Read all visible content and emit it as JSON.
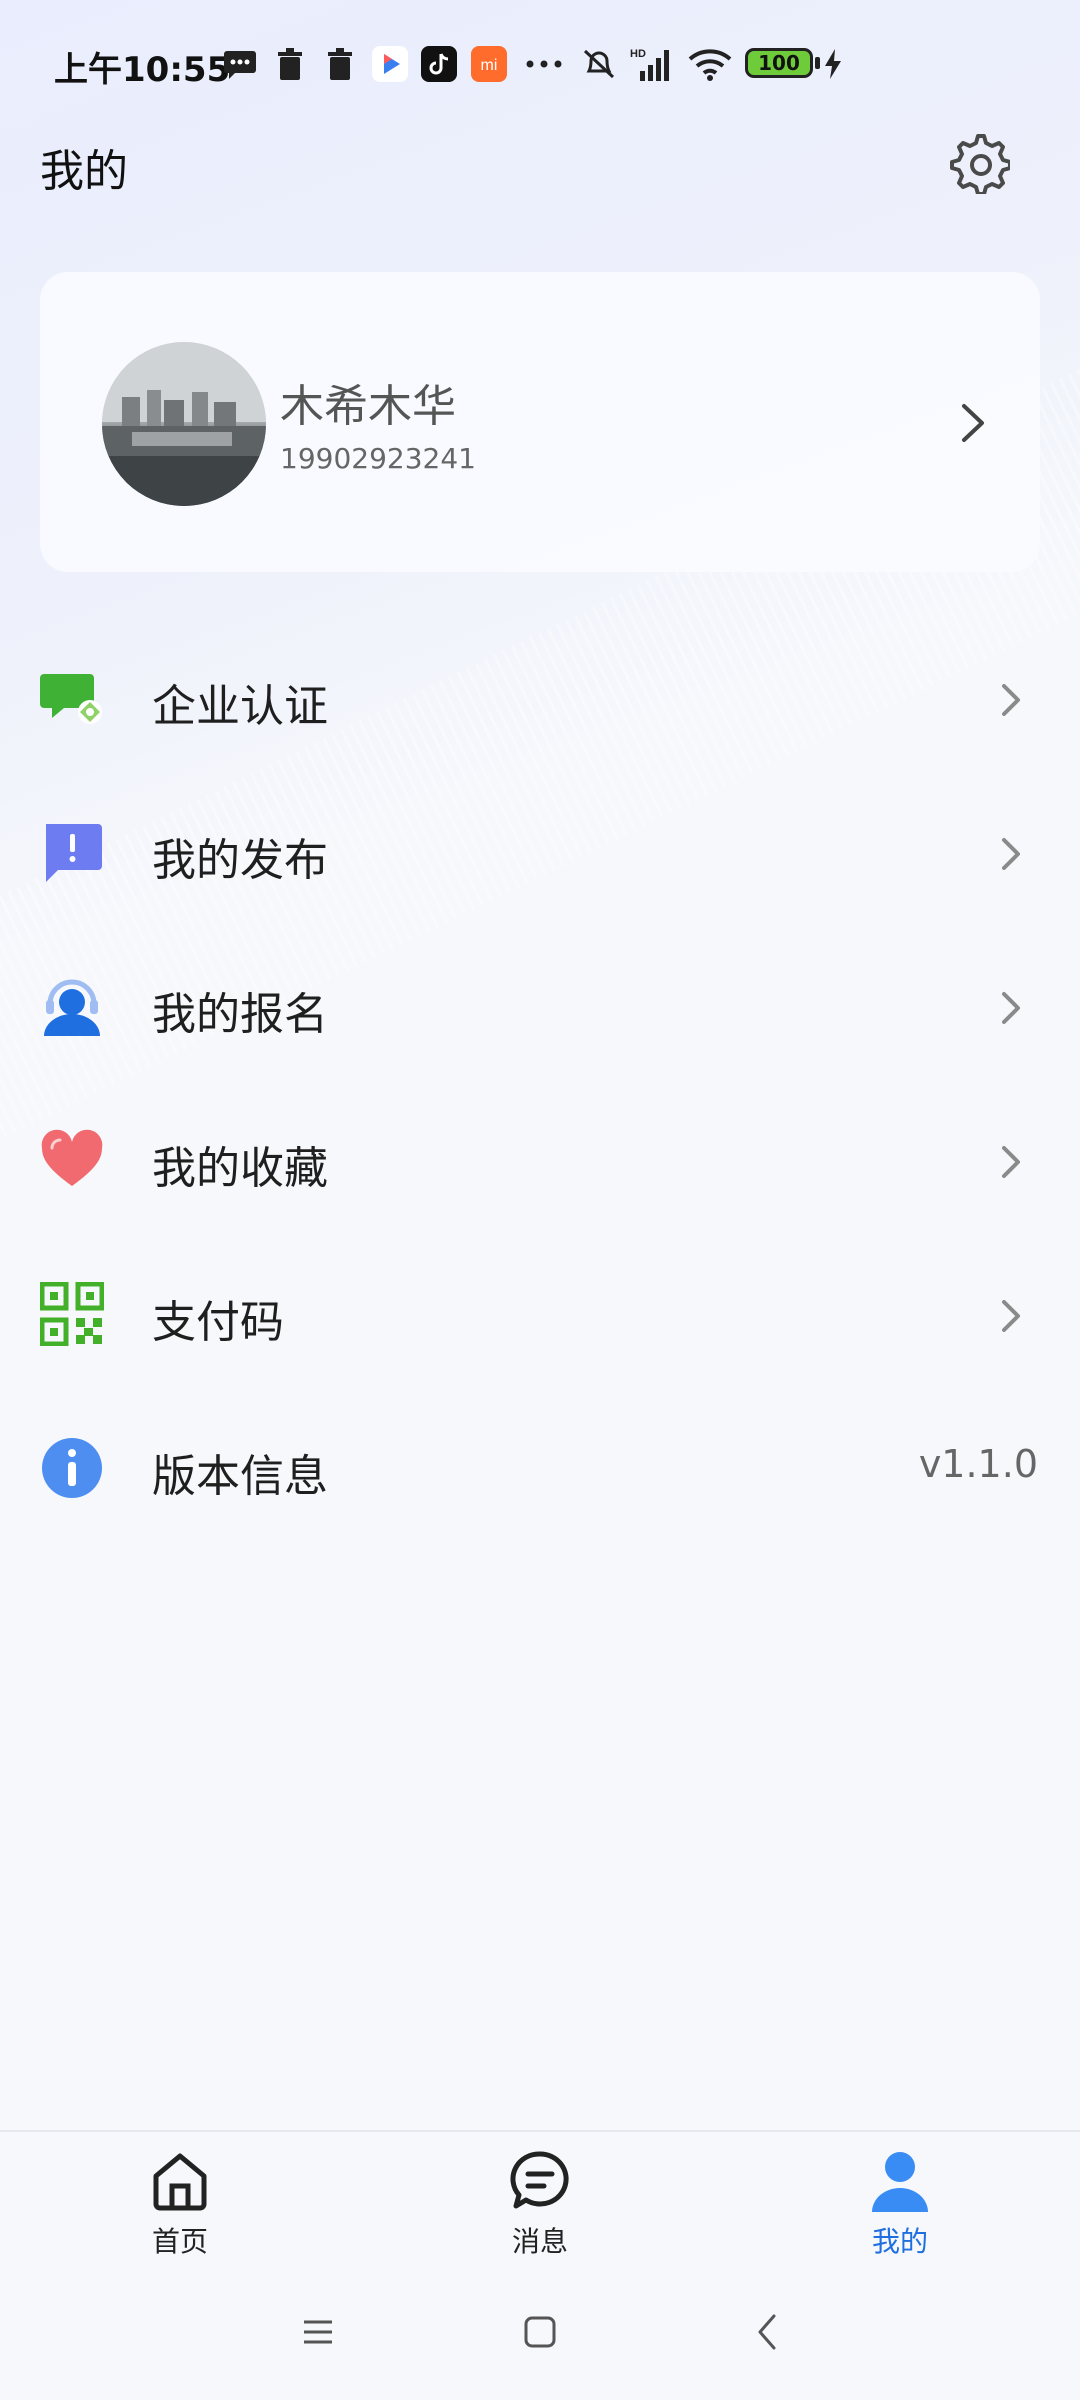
{
  "status_bar": {
    "time": "上午10:55",
    "battery_level": "100",
    "icons": [
      "message-icon",
      "trash-icon",
      "trash-icon",
      "video-app-icon",
      "tiktok-icon",
      "mi-icon",
      "more-icon",
      "mute-icon",
      "hd-signal-icon",
      "wifi-icon",
      "battery-icon",
      "charging-icon"
    ]
  },
  "header": {
    "title": "我的",
    "settings_icon": "gear-icon"
  },
  "profile": {
    "name": "木希木华",
    "phone": "19902923241"
  },
  "menu": {
    "items": [
      {
        "label": "企业认证",
        "icon": "enterprise-certification-icon",
        "color": "#3fb134"
      },
      {
        "label": "我的发布",
        "icon": "my-publish-icon",
        "color": "#6d7cf0"
      },
      {
        "label": "我的报名",
        "icon": "my-signup-icon",
        "color": "#1f6fe0"
      },
      {
        "label": "我的收藏",
        "icon": "heart-icon",
        "color": "#f06a6f"
      },
      {
        "label": "支付码",
        "icon": "qr-code-icon",
        "color": "#43b02a"
      },
      {
        "label": "版本信息",
        "icon": "info-icon",
        "color": "#4d8ef0",
        "value": "v1.1.0"
      }
    ]
  },
  "bottom_nav": {
    "items": [
      {
        "label": "首页",
        "icon": "home-icon",
        "active": false
      },
      {
        "label": "消息",
        "icon": "message-bubble-icon",
        "active": false
      },
      {
        "label": "我的",
        "icon": "person-icon",
        "active": true
      }
    ],
    "accent": "#1f6fe0"
  },
  "system_nav": {
    "icons": [
      "menu-icon",
      "home-square-icon",
      "back-icon"
    ]
  }
}
